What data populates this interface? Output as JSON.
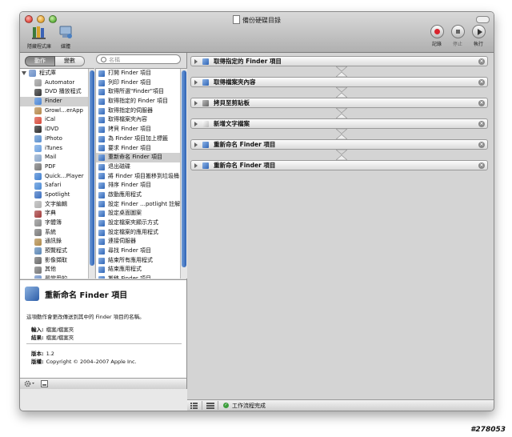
{
  "window": {
    "title": "備份硬碟目錄"
  },
  "toolbar": {
    "hide_library_label": "隱藏程式庫",
    "media_label": "媒體",
    "record_label": "記錄",
    "stop_label": "停止",
    "run_label": "執行"
  },
  "left_panel": {
    "tabs": [
      {
        "label": "動作",
        "selected": true
      },
      {
        "label": "變數",
        "selected": false
      }
    ],
    "search": {
      "placeholder": "名稱"
    },
    "library": [
      {
        "label": "程式庫",
        "icon": "library-icon",
        "color": "#6b8fc7"
      },
      {
        "label": "Automator",
        "icon": "automator-icon",
        "color": "#9a9a9a"
      },
      {
        "label": "DVD 播放程式",
        "icon": "dvd-player-icon",
        "color": "#333333"
      },
      {
        "label": "Finder",
        "icon": "finder-icon",
        "color": "#4a86d6",
        "selected": true
      },
      {
        "label": "Growl…erApp",
        "icon": "growl-icon",
        "color": "#b5884a"
      },
      {
        "label": "iCal",
        "icon": "ical-icon",
        "color": "#d84a3a"
      },
      {
        "label": "iDVD",
        "icon": "idvd-icon",
        "color": "#2a2a2a"
      },
      {
        "label": "iPhoto",
        "icon": "iphoto-icon",
        "color": "#5a8fce"
      },
      {
        "label": "iTunes",
        "icon": "itunes-icon",
        "color": "#6aa0e0"
      },
      {
        "label": "Mail",
        "icon": "mail-icon",
        "color": "#8aa6c9"
      },
      {
        "label": "PDF",
        "icon": "pdf-icon",
        "color": "#777777"
      },
      {
        "label": "Quick…Player",
        "icon": "quicktime-icon",
        "color": "#3f7fd0"
      },
      {
        "label": "Safari",
        "icon": "safari-icon",
        "color": "#4a8ad6"
      },
      {
        "label": "Spotlight",
        "icon": "spotlight-icon",
        "color": "#3a6fc0"
      },
      {
        "label": "文字編輯",
        "icon": "textedit-icon",
        "color": "#b0b0b0"
      },
      {
        "label": "字典",
        "icon": "dictionary-icon",
        "color": "#a23a3a"
      },
      {
        "label": "字體簿",
        "icon": "fontbook-icon",
        "color": "#8a8a8a"
      },
      {
        "label": "系統",
        "icon": "system-icon",
        "color": "#777777"
      },
      {
        "label": "通訊錄",
        "icon": "address-book-icon",
        "color": "#b08a4a"
      },
      {
        "label": "預覽程式",
        "icon": "preview-icon",
        "color": "#5a86b5"
      },
      {
        "label": "影像擷取",
        "icon": "image-capture-icon",
        "color": "#6a6a6a"
      },
      {
        "label": "其他",
        "icon": "other-icon",
        "color": "#777777"
      },
      {
        "label": "最常用的",
        "icon": "most-used-icon",
        "color": "#6b8fc7"
      }
    ],
    "actions": [
      {
        "label": "打開 Finder 項目"
      },
      {
        "label": "列印 Finder 項目"
      },
      {
        "label": "取得所選\"Finder\"項目"
      },
      {
        "label": "取得指定的 Finder 項目"
      },
      {
        "label": "取得指定的伺服器"
      },
      {
        "label": "取得檔案夾內容"
      },
      {
        "label": "拷貝 Finder 項目"
      },
      {
        "label": "為 Finder 項目加上標籤"
      },
      {
        "label": "要求 Finder 項目"
      },
      {
        "label": "重新命名 Finder 項目",
        "selected": true
      },
      {
        "label": "退出磁碟"
      },
      {
        "label": "將 Finder 項目搬移到垃圾桶"
      },
      {
        "label": "排序 Finder 項目"
      },
      {
        "label": "啟動應用程式"
      },
      {
        "label": "設定 Finder …potlight 註解\""
      },
      {
        "label": "設定桌面圖案"
      },
      {
        "label": "設定檔案夾顯示方式"
      },
      {
        "label": "設定檔案的應用程式"
      },
      {
        "label": "連接伺服器"
      },
      {
        "label": "尋找 Finder 項目"
      },
      {
        "label": "結束所有應用程式"
      },
      {
        "label": "結束應用程式"
      },
      {
        "label": "搬移 Finder 項目"
      }
    ],
    "description": {
      "title": "重新命名 Finder 項目",
      "summary": "這項動作會更改傳送到其中的 Finder 項目的名稱。",
      "input_label": "輸入:",
      "input_value": "檔案/檔案夾",
      "result_label": "結果:",
      "result_value": "檔案/檔案夾",
      "version_label": "版本:",
      "version_value": "1.2",
      "copyright_label": "版權:",
      "copyright_value": "Copyright © 2004–2007 Apple Inc."
    }
  },
  "workflow": {
    "steps": [
      {
        "label": "取得指定的 Finder 項目",
        "icon": "finder-icon"
      },
      {
        "label": "取得檔案夾內容",
        "icon": "finder-icon"
      },
      {
        "label": "拷貝至剪貼板",
        "icon": "scissors-icon"
      },
      {
        "label": "新增文字檔案",
        "icon": "textedit-icon"
      },
      {
        "label": "重新命名 Finder 項目",
        "icon": "finder-icon"
      },
      {
        "label": "重新命名 Finder 項目",
        "icon": "finder-icon"
      }
    ],
    "status": "工作流程完成"
  },
  "watermark": "#278053"
}
